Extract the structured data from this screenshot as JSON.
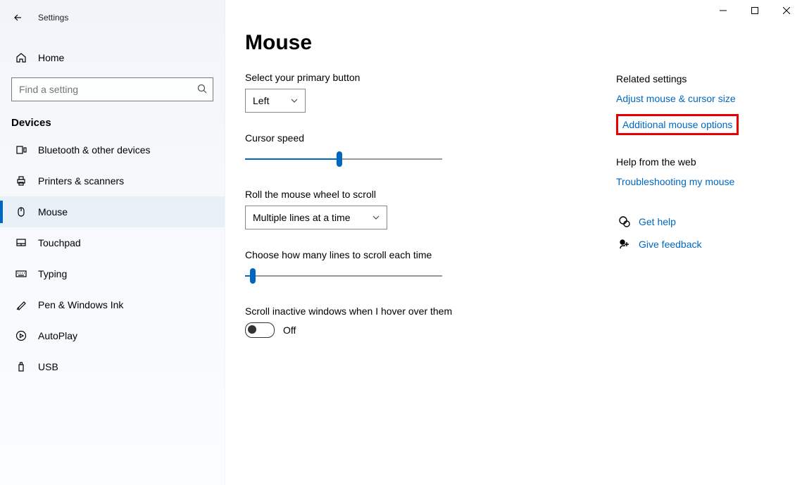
{
  "window": {
    "title": "Settings"
  },
  "sidebar": {
    "home_label": "Home",
    "search_placeholder": "Find a setting",
    "group_label": "Devices",
    "items": [
      {
        "label": "Bluetooth & other devices"
      },
      {
        "label": "Printers & scanners"
      },
      {
        "label": "Mouse"
      },
      {
        "label": "Touchpad"
      },
      {
        "label": "Typing"
      },
      {
        "label": "Pen & Windows Ink"
      },
      {
        "label": "AutoPlay"
      },
      {
        "label": "USB"
      }
    ]
  },
  "page": {
    "title": "Mouse",
    "primary_button": {
      "label": "Select your primary button",
      "value": "Left"
    },
    "cursor_speed": {
      "label": "Cursor speed",
      "percent": 48
    },
    "wheel_mode": {
      "label": "Roll the mouse wheel to scroll",
      "value": "Multiple lines at a time"
    },
    "lines_per_scroll": {
      "label": "Choose how many lines to scroll each time",
      "percent": 4
    },
    "scroll_inactive": {
      "label": "Scroll inactive windows when I hover over them",
      "state": "Off"
    }
  },
  "related": {
    "title": "Related settings",
    "adjust_link": "Adjust mouse & cursor size",
    "additional_link": "Additional mouse options"
  },
  "help": {
    "title": "Help from the web",
    "troubleshoot_link": "Troubleshooting my mouse",
    "get_help": "Get help",
    "feedback": "Give feedback"
  }
}
